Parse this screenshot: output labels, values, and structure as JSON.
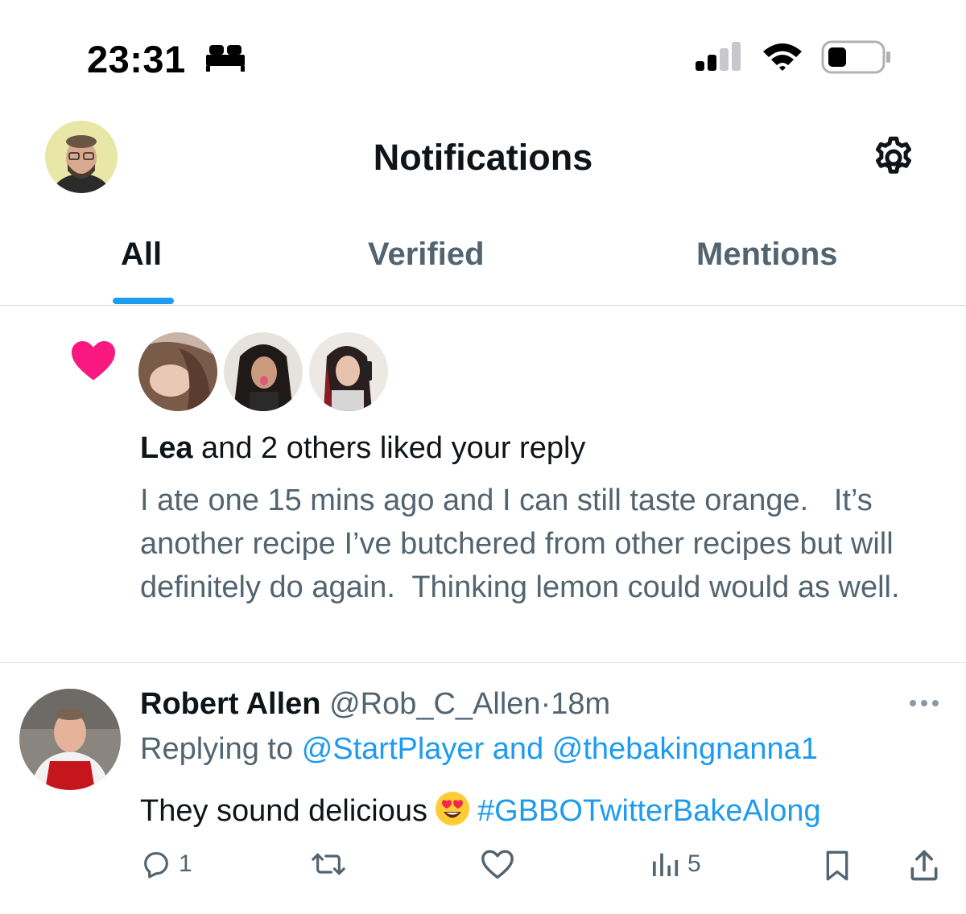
{
  "status_bar": {
    "time": "23:31",
    "icons": [
      "bed-icon",
      "cellular-signal-icon",
      "wifi-icon",
      "battery-icon"
    ]
  },
  "header": {
    "title": "Notifications",
    "icons": [
      "profile-avatar",
      "gear-icon"
    ]
  },
  "tabs": [
    {
      "label": "All",
      "active": true
    },
    {
      "label": "Verified",
      "active": false
    },
    {
      "label": "Mentions",
      "active": false
    }
  ],
  "like_notification": {
    "icon": "heart-icon",
    "liker_name": "Lea",
    "summary_rest": "and 2 others liked your reply",
    "reply_text": "I ate one 15 mins ago and I can still taste orange.   It’s another recipe I’ve butchered from other recipes but will definitely do again.  Thinking lemon could would as well."
  },
  "tweet": {
    "name": "Robert Allen",
    "handle": "@Rob_C_Allen",
    "separator": "·",
    "time": "18m",
    "replying_prefix": "Replying to",
    "mention_1": "@StartPlayer",
    "mention_joiner": "and",
    "mention_2": "@thebakingnanna1",
    "text": "They sound delicious",
    "emoji": "heart-eyes-emoji",
    "hashtag": "#GBBOTwitterBakeAlong",
    "actions": {
      "reply_count": "1",
      "retweet_count": "",
      "like_count": "",
      "view_count": "5"
    }
  },
  "colors": {
    "accent": "#1d9bf0",
    "like": "#f91880",
    "text_primary": "#0f1419",
    "text_secondary": "#536471",
    "divider": "#cfd9de"
  }
}
